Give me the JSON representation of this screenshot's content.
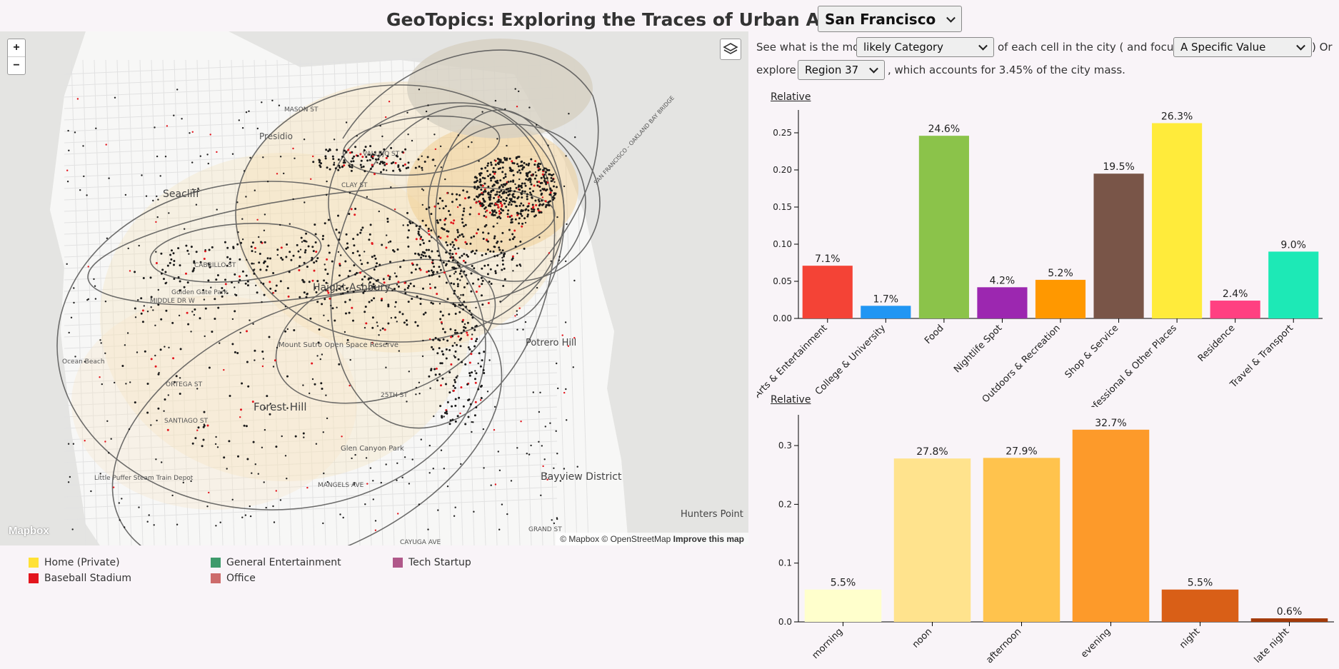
{
  "header": {
    "title": "GeoTopics: Exploring the Traces of Urban Activity in",
    "city": "San Francisco"
  },
  "controls": {
    "text1": "See what is the most",
    "mode": "likely Category",
    "text2": "of each cell in the city ( and focus on",
    "focus": "A Specific Value",
    "text3": ") Or",
    "text4": "explore",
    "region": "Region 37",
    "text5": ", which accounts for 3.45% of the city mass."
  },
  "map": {
    "zoom_in": "+",
    "zoom_out": "−",
    "logo": "Mapbox",
    "attribution": "© Mapbox © OpenStreetMap",
    "improve": "Improve this map",
    "place_labels": [
      "Presidio",
      "Seacliff",
      "Haight-Ashbury",
      "Mount Sutro Open Space Reserve",
      "Forest Hill",
      "Glen Canyon Park",
      "Bayview District",
      "Hunters Point",
      "Potrero Hill",
      "Ocean Beach",
      "Little Puffer Steam Train Depot",
      "Golden Gate Park",
      "MANGELS AVE",
      "CABRILLO ST",
      "MIDDLE DR W",
      "CLAY ST",
      "VALLEJO ST",
      "MASON ST",
      "ORTEGA ST",
      "SANTIAGO ST",
      "25TH ST",
      "CAYUGA AVE",
      "GRAND ST",
      "SAN FRANCISCO - OAKLAND BAY BRIDGE"
    ]
  },
  "legend": [
    {
      "label": "Home (Private)",
      "color": "#ffe135"
    },
    {
      "label": "General Entertainment",
      "color": "#3e9a6b"
    },
    {
      "label": "Tech Startup",
      "color": "#b0588a"
    },
    {
      "label": "Baseball Stadium",
      "color": "#e3151d"
    },
    {
      "label": "Office",
      "color": "#cd6b6b"
    }
  ],
  "chart_data": [
    {
      "type": "bar",
      "label": "Relative",
      "categories": [
        "Arts & Entertainment",
        "College & University",
        "Food",
        "Nightlife Spot",
        "Outdoors & Recreation",
        "Shop & Service",
        "Professional & Other Places",
        "Residence",
        "Travel & Transport"
      ],
      "values": [
        0.071,
        0.017,
        0.246,
        0.042,
        0.052,
        0.195,
        0.263,
        0.024,
        0.09
      ],
      "data_labels": [
        "7.1%",
        "1.7%",
        "24.6%",
        "4.2%",
        "5.2%",
        "19.5%",
        "26.3%",
        "2.4%",
        "9.0%"
      ],
      "colors": [
        "#f44336",
        "#2196f3",
        "#8bc34a",
        "#9c27b0",
        "#ff9800",
        "#795548",
        "#ffeb3b",
        "#ff4081",
        "#1de9b6"
      ],
      "yticks": [
        "0.00",
        "0.05",
        "0.10",
        "0.15",
        "0.20",
        "0.25"
      ],
      "ylim": [
        0,
        0.275
      ]
    },
    {
      "type": "bar",
      "label": "Relative",
      "categories": [
        "morning",
        "noon",
        "afternoon",
        "evening",
        "night",
        "late night"
      ],
      "values": [
        0.055,
        0.278,
        0.279,
        0.327,
        0.055,
        0.006
      ],
      "data_labels": [
        "5.5%",
        "27.8%",
        "27.9%",
        "32.7%",
        "5.5%",
        "0.6%"
      ],
      "colors": [
        "#ffffcc",
        "#ffe38d",
        "#ffc34d",
        "#fd9a2a",
        "#d95f17",
        "#a33a0a"
      ],
      "yticks": [
        "0.0",
        "0.1",
        "0.2",
        "0.3"
      ],
      "ylim": [
        0,
        0.345
      ]
    }
  ]
}
